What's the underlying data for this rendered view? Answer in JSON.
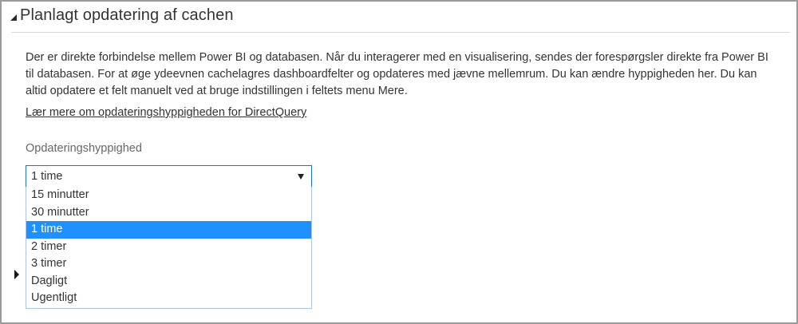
{
  "section": {
    "title": "Planlagt opdatering af cachen",
    "icon": "triangle-expanded-icon"
  },
  "description": "Der er direkte forbindelse mellem Power BI og databasen. Når du interagerer med en visualisering, sendes der forespørgsler direkte fra Power BI til databasen. For at øge ydeevnen cachelagres dashboardfelter og opdateres med jævne mellemrum. Du kan ændre hyppigheden her. Du kan altid opdatere et felt manuelt ved at bruge indstillingen i feltets menu Mere.",
  "link": {
    "label": "Lær mere om opdateringshyppigheden for DirectQuery"
  },
  "frequency": {
    "label": "Opdateringshyppighed",
    "selected": "1 time",
    "selected_index": 2,
    "options": [
      "15 minutter",
      "30 minutter",
      "1 time",
      "2 timer",
      "3 timer",
      "Dagligt",
      "Ugentligt"
    ]
  },
  "colors": {
    "accent": "#1e90ff",
    "select_border": "#1f6fd0",
    "frame_border": "#9b9b9b"
  }
}
